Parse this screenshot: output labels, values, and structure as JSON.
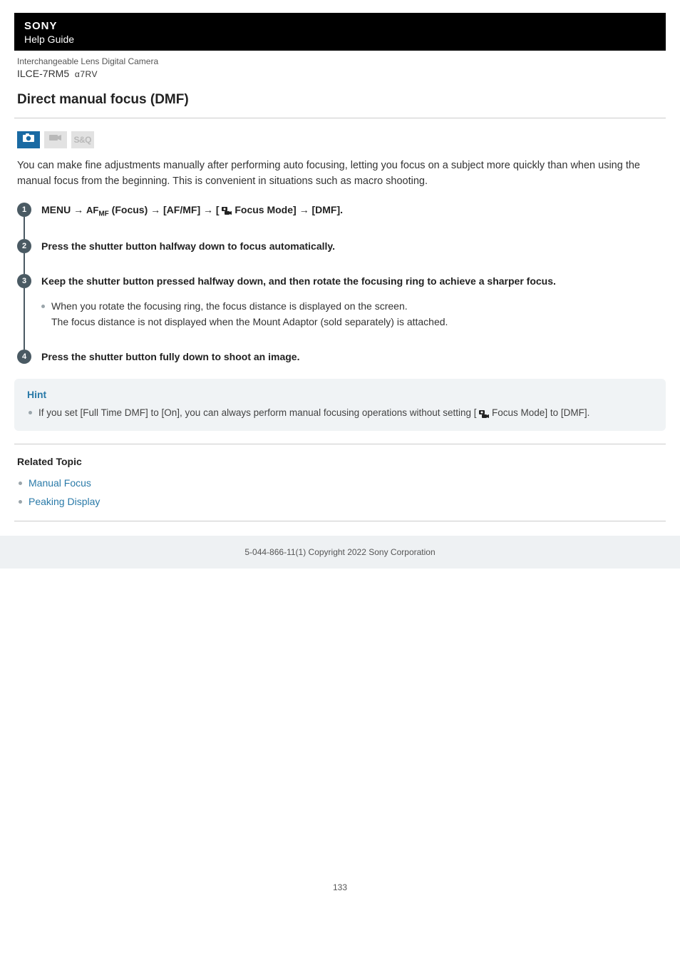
{
  "header": {
    "brand": "SONY",
    "guide": "Help Guide",
    "product_type": "Interchangeable Lens Digital Camera",
    "model": "ILCE-7RM5",
    "model_suffix": "α7RV"
  },
  "page": {
    "title": "Direct manual focus (DMF)",
    "intro": "You can make fine adjustments manually after performing auto focusing, letting you focus on a subject more quickly than when using the manual focus from the beginning. This is convenient in situations such as macro shooting.",
    "page_number": "133"
  },
  "mode_icons": {
    "photo_label": "photo-mode-icon",
    "video_label": "video-mode-icon",
    "sq_text": "S&Q"
  },
  "steps": [
    {
      "num": "1",
      "head_pre": "MENU → ",
      "af_tag": "AF",
      "mf_tag": "MF",
      "head_mid1": " (Focus) → [AF/MF] → [ ",
      "head_mid2": " Focus Mode] → [DMF]."
    },
    {
      "num": "2",
      "head": "Press the shutter button halfway down to focus automatically."
    },
    {
      "num": "3",
      "head": "Keep the shutter button pressed halfway down, and then rotate the focusing ring to achieve a sharper focus.",
      "sub1": "When you rotate the focusing ring, the focus distance is displayed on the screen.",
      "sub2": "The focus distance is not displayed when the Mount Adaptor (sold separately) is attached."
    },
    {
      "num": "4",
      "head": "Press the shutter button fully down to shoot an image."
    }
  ],
  "hint": {
    "title": "Hint",
    "text_pre": "If you set [Full Time DMF] to [On], you can always perform manual focusing operations without setting [ ",
    "text_post": " Focus Mode] to [DMF]."
  },
  "related": {
    "title": "Related Topic",
    "links": [
      "Manual Focus",
      "Peaking Display"
    ]
  },
  "footer": {
    "copyright": "5-044-866-11(1) Copyright 2022 Sony Corporation"
  }
}
